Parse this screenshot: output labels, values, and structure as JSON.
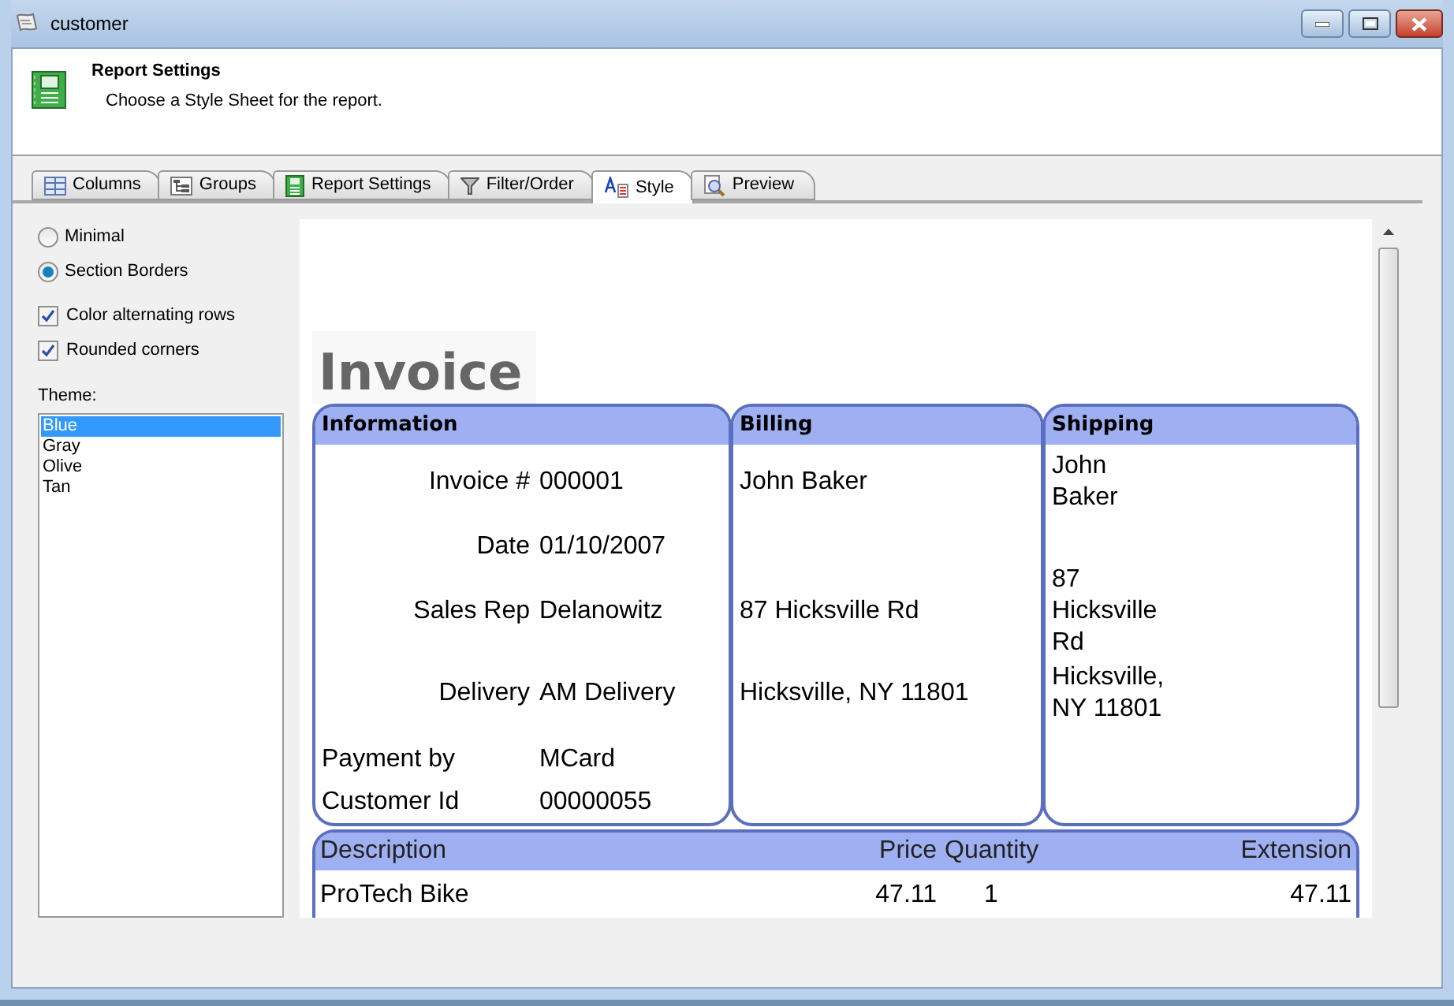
{
  "window": {
    "title": "customer"
  },
  "header": {
    "title": "Report Settings",
    "subtitle": "Choose a Style Sheet for the report."
  },
  "tabs": [
    {
      "label": "Columns",
      "selected": false
    },
    {
      "label": "Groups",
      "selected": false
    },
    {
      "label": "Report Settings",
      "selected": false
    },
    {
      "label": "Filter/Order",
      "selected": false
    },
    {
      "label": "Style",
      "selected": true
    },
    {
      "label": "Preview",
      "selected": false
    }
  ],
  "border_options": [
    {
      "label": "Minimal",
      "selected": false
    },
    {
      "label": "Section Borders",
      "selected": true
    }
  ],
  "checkboxes": [
    {
      "label": "Color alternating rows",
      "checked": true
    },
    {
      "label": "Rounded corners",
      "checked": true
    }
  ],
  "theme": {
    "label": "Theme:",
    "items": [
      {
        "label": "Blue",
        "selected": true
      },
      {
        "label": "Gray",
        "selected": false
      },
      {
        "label": "Olive",
        "selected": false
      },
      {
        "label": "Tan",
        "selected": false
      }
    ]
  },
  "preview": {
    "title": "Invoice",
    "information": {
      "heading": "Information",
      "fields": [
        {
          "label": "Invoice #",
          "value": "000001",
          "kind": "aligned"
        },
        {
          "label": "Date",
          "value": "01/10/2007",
          "kind": "aligned"
        },
        {
          "label": "Sales Rep",
          "value": "Delanowitz",
          "kind": "aligned"
        },
        {
          "label": "Delivery",
          "value": "AM Delivery",
          "kind": "aligned"
        },
        {
          "label": "Payment by",
          "value": "MCard",
          "kind": "plain"
        },
        {
          "label": "Customer Id",
          "value": "00000055",
          "kind": "plain"
        }
      ]
    },
    "billing": {
      "heading": "Billing",
      "name": "John Baker",
      "street": "87 Hicksville Rd",
      "city": "Hicksville, NY 11801"
    },
    "shipping": {
      "heading": "Shipping",
      "name": "John Baker",
      "street": "87 Hicksville Rd",
      "city": "Hicksville, NY 11801"
    },
    "items": {
      "columns": [
        "Description",
        "Price",
        "Quantity",
        "Extension"
      ],
      "rows": [
        {
          "description": "ProTech Bike",
          "price": "47.11",
          "quantity": "1",
          "extension": "47.11"
        }
      ]
    }
  }
}
